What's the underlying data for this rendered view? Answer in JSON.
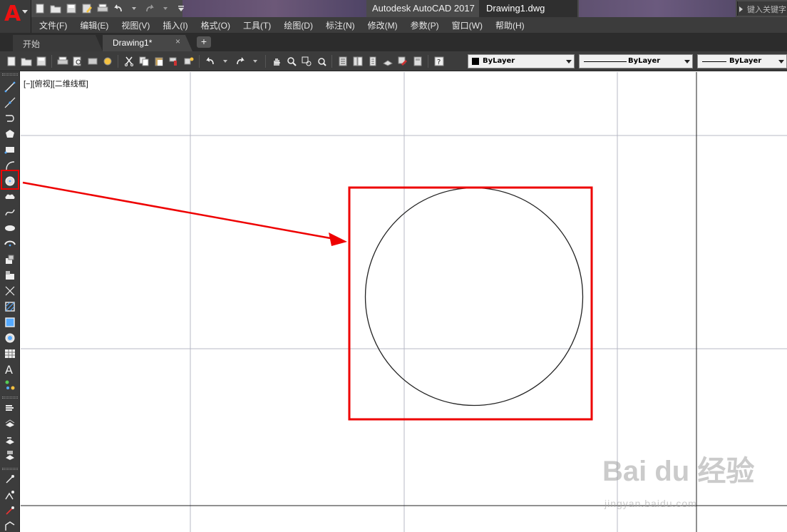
{
  "window": {
    "title": "Autodesk AutoCAD 2017",
    "document": "Drawing1.dwg",
    "search_placeholder": "键入关键字"
  },
  "menu": [
    "文件(F)",
    "编辑(E)",
    "视图(V)",
    "插入(I)",
    "格式(O)",
    "工具(T)",
    "绘图(D)",
    "标注(N)",
    "修改(M)",
    "参数(P)",
    "窗口(W)",
    "帮助(H)"
  ],
  "tabs": {
    "start": "开始",
    "drawing": "Drawing1*",
    "close": "×",
    "add": "+"
  },
  "properties": {
    "color": "ByLayer",
    "linetype": "ByLayer",
    "lineweight": "ByLayer"
  },
  "viewport": {
    "label": "[−][俯视][二维线框]"
  },
  "annotation": {
    "highlight_color": "#e00000",
    "highlighted_tool": "circle-tool"
  },
  "watermark": {
    "brand": "Bai du 经验",
    "url": "jingyan.baidu.com"
  },
  "colors": {
    "app_logo": "#e11111",
    "ui_dark": "#3c3c3c",
    "canvas": "#ffffff"
  }
}
